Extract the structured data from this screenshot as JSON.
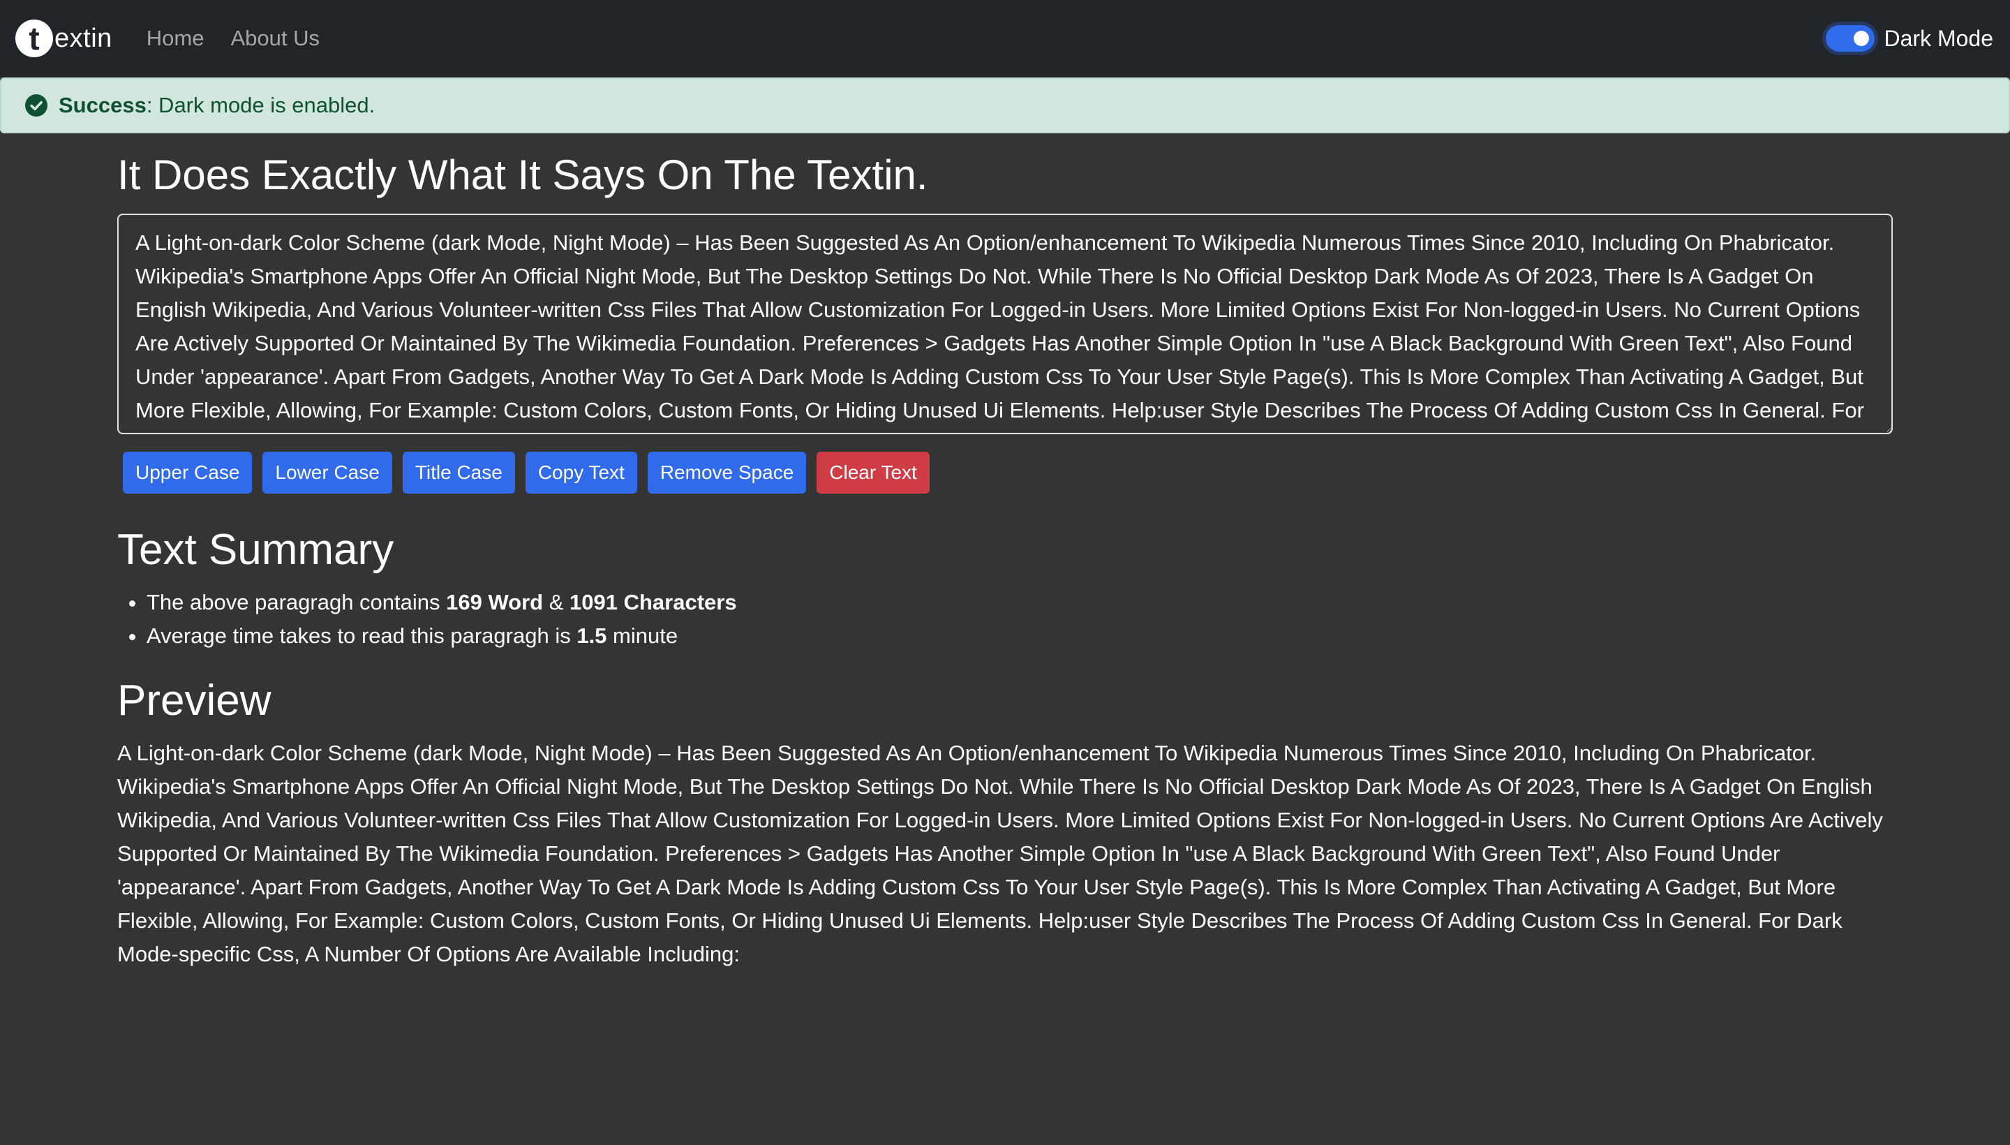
{
  "navbar": {
    "logo_letter": "t",
    "brand_rest": "extin",
    "links": [
      "Home",
      "About Us"
    ],
    "toggle_label": "Dark Mode",
    "toggle_on": true
  },
  "alert": {
    "strong": "Success",
    "message": ": Dark mode is enabled.",
    "icon": "check-circle-icon"
  },
  "main": {
    "title": "It Does Exactly What It Says On The Textin.",
    "textarea_value": "A Light-on-dark Color Scheme (dark Mode, Night Mode) – Has Been Suggested As An Option/enhancement To Wikipedia Numerous Times Since 2010, Including On Phabricator. Wikipedia's Smartphone Apps Offer An Official Night Mode, But The Desktop Settings Do Not. While There Is No Official Desktop Dark Mode As Of 2023, There Is A Gadget On English Wikipedia, And Various Volunteer-written Css Files That Allow Customization For Logged-in Users. More Limited Options Exist For Non-logged-in Users. No Current Options Are Actively Supported Or Maintained By The Wikimedia Foundation. Preferences > Gadgets Has Another Simple Option In \"use A Black Background With Green Text\", Also Found Under 'appearance'. Apart From Gadgets, Another Way To Get A Dark Mode Is Adding Custom Css To Your User Style Page(s). This Is More Complex Than Activating A Gadget, But More Flexible, Allowing, For Example: Custom Colors, Custom Fonts, Or Hiding Unused Ui Elements. Help:user Style Describes The Process Of Adding Custom Css In General. For Dark Mode-specific Css, A Number Of Options Are Available Including:",
    "buttons": {
      "upper": "Upper Case",
      "lower": "Lower Case",
      "title": "Title Case",
      "copy": "Copy Text",
      "remove_space": "Remove Space",
      "clear": "Clear Text"
    }
  },
  "summary": {
    "heading": "Text Summary",
    "line1_prefix": "The above paragragh contains ",
    "words": "169 Word",
    "amp": " & ",
    "chars": "1091 Characters",
    "line2_prefix": "Average time takes to read this paragragh is ",
    "minutes": "1.5",
    "line2_suffix": " minute"
  },
  "preview": {
    "heading": "Preview",
    "text": "A Light-on-dark Color Scheme (dark Mode, Night Mode) – Has Been Suggested As An Option/enhancement To Wikipedia Numerous Times Since 2010, Including On Phabricator. Wikipedia's Smartphone Apps Offer An Official Night Mode, But The Desktop Settings Do Not. While There Is No Official Desktop Dark Mode As Of 2023, There Is A Gadget On English Wikipedia, And Various Volunteer-written Css Files That Allow Customization For Logged-in Users. More Limited Options Exist For Non-logged-in Users. No Current Options Are Actively Supported Or Maintained By The Wikimedia Foundation. Preferences > Gadgets Has Another Simple Option In \"use A Black Background With Green Text\", Also Found Under 'appearance'. Apart From Gadgets, Another Way To Get A Dark Mode Is Adding Custom Css To Your User Style Page(s). This Is More Complex Than Activating A Gadget, But More Flexible, Allowing, For Example: Custom Colors, Custom Fonts, Or Hiding Unused Ui Elements. Help:user Style Describes The Process Of Adding Custom Css In General. For Dark Mode-specific Css, A Number Of Options Are Available Including:"
  },
  "colors": {
    "page_bg": "#343434",
    "navbar_bg": "#212529",
    "primary": "#2f6bea",
    "danger": "#d03c46",
    "alert_bg": "#d1e7dd",
    "alert_text": "#0f5132"
  }
}
